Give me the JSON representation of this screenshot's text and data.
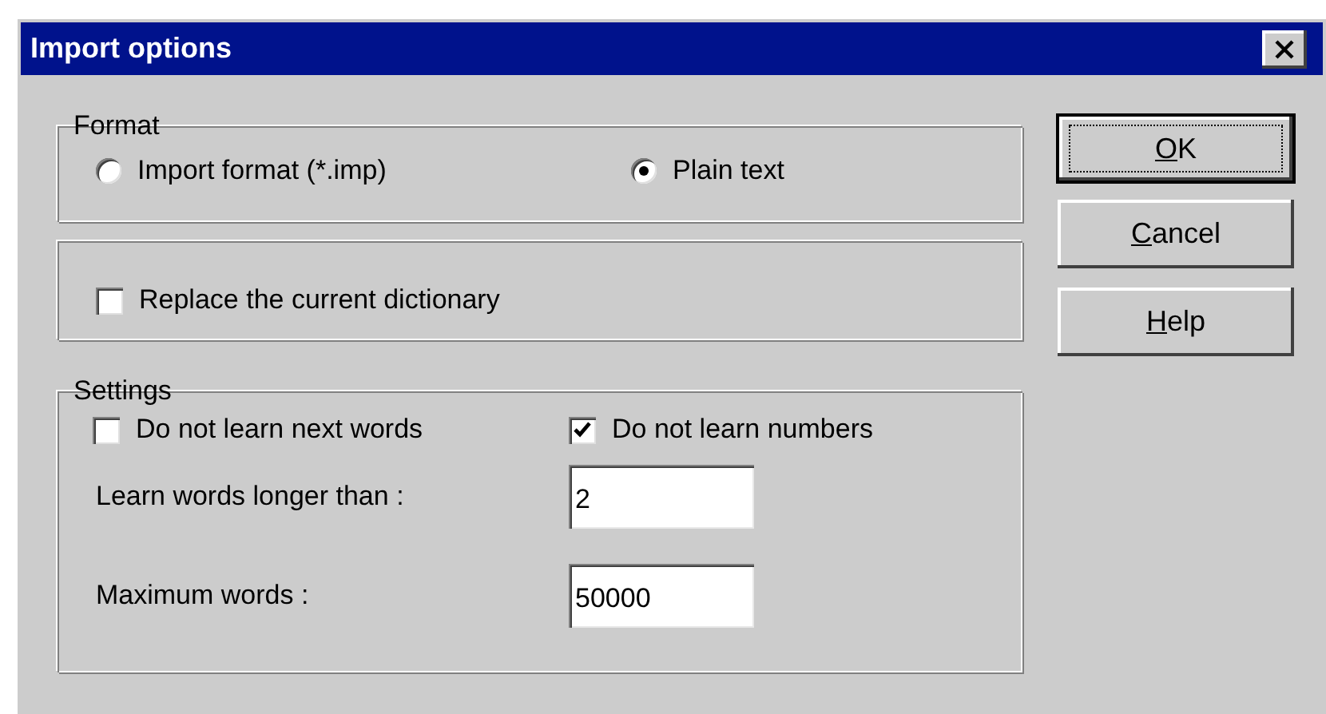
{
  "window": {
    "title": "Import options"
  },
  "format": {
    "legend": "Format",
    "options": [
      {
        "label": "Import format (*.imp)",
        "selected": false
      },
      {
        "label": "Plain text",
        "selected": true
      }
    ]
  },
  "replace": {
    "label": "Replace the current dictionary",
    "checked": false
  },
  "settings": {
    "legend": "Settings",
    "checkboxes": [
      {
        "label": "Do not learn next words",
        "checked": false
      },
      {
        "label": "Do not learn numbers",
        "checked": true
      }
    ],
    "fields": [
      {
        "label": "Learn words longer than :",
        "value": "2"
      },
      {
        "label": "Maximum words :",
        "value": "50000"
      }
    ]
  },
  "buttons": [
    {
      "label": "OK",
      "default": true,
      "mnemonic": true
    },
    {
      "label": "Cancel",
      "default": false,
      "mnemonic": true
    },
    {
      "label": "Help",
      "default": false,
      "mnemonic": true
    }
  ]
}
